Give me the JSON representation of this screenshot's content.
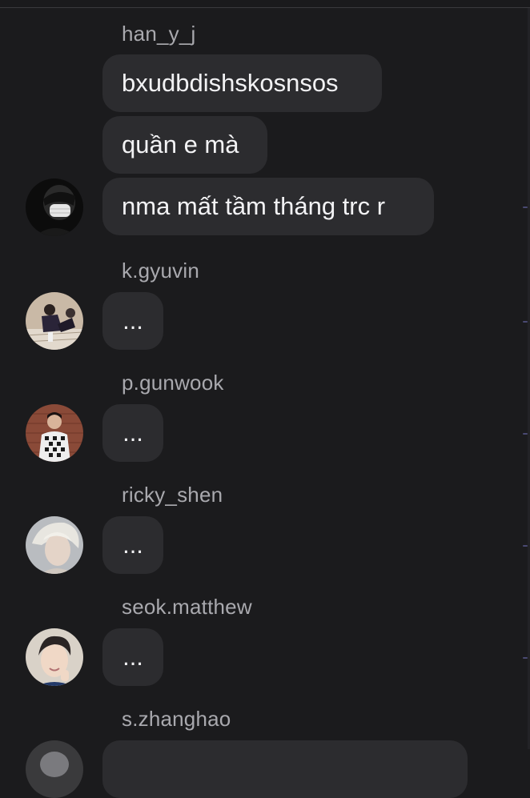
{
  "messages": [
    {
      "sender": "han_y_j",
      "lines": [
        "bxudbdishskosnsos",
        "quần e mà",
        "nma mất tầm tháng trc r"
      ]
    },
    {
      "sender": "k.gyuvin",
      "text": "..."
    },
    {
      "sender": "p.gunwook",
      "text": "..."
    },
    {
      "sender": "ricky_shen",
      "text": "..."
    },
    {
      "sender": "seok.matthew",
      "text": "..."
    },
    {
      "sender": "s.zhanghao",
      "text": ""
    }
  ],
  "colors": {
    "background": "#1b1b1d",
    "bubble": "#2c2c2f",
    "sender_name": "#a9a9ae",
    "message_text": "#f2f2f4"
  },
  "icons": [
    "avatar-han-y-j",
    "avatar-k-gyuvin",
    "avatar-p-gunwook",
    "avatar-ricky-shen",
    "avatar-seok-matthew",
    "avatar-s-zhanghao"
  ]
}
